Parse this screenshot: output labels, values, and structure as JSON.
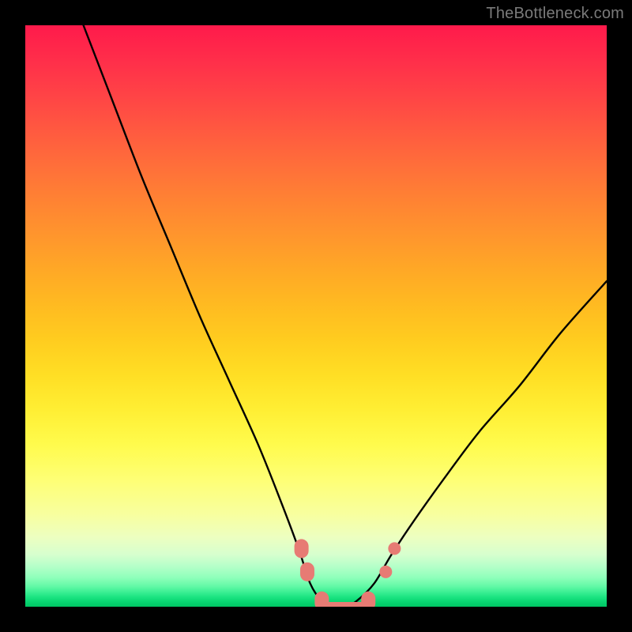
{
  "watermark": "TheBottleneck.com",
  "chart_data": {
    "type": "line",
    "title": "",
    "xlabel": "",
    "ylabel": "",
    "xlim": [
      0,
      100
    ],
    "ylim": [
      0,
      100
    ],
    "grid": false,
    "legend": false,
    "background_gradient": {
      "direction": "vertical",
      "stops": [
        {
          "pos": 0,
          "color": "#ff1a4b"
        },
        {
          "pos": 50,
          "color": "#ffc51f"
        },
        {
          "pos": 90,
          "color": "#d7ffce"
        },
        {
          "pos": 100,
          "color": "#01c764"
        }
      ]
    },
    "series": [
      {
        "name": "bottleneck-curve",
        "color": "#000000",
        "x": [
          10,
          15,
          20,
          25,
          30,
          35,
          40,
          44,
          47,
          49,
          51,
          53,
          55,
          57,
          60,
          63,
          67,
          72,
          78,
          85,
          92,
          100
        ],
        "values": [
          100,
          87,
          74,
          62,
          50,
          39,
          28,
          18,
          10,
          4,
          1,
          0,
          0,
          1,
          4,
          9,
          15,
          22,
          30,
          38,
          47,
          56
        ]
      }
    ],
    "markers": [
      {
        "name": "left-cluster-top",
        "x": 47.5,
        "y": 10,
        "color": "#e77b74",
        "shape": "pill"
      },
      {
        "name": "left-cluster-mid",
        "x": 48.5,
        "y": 6,
        "color": "#e77b74",
        "shape": "pill"
      },
      {
        "name": "trough-left",
        "x": 51,
        "y": 1,
        "color": "#e77b74",
        "shape": "pill"
      },
      {
        "name": "trough-center",
        "x": 55,
        "y": 0,
        "color": "#e77b74",
        "shape": "pill-wide"
      },
      {
        "name": "trough-right",
        "x": 59,
        "y": 1,
        "color": "#e77b74",
        "shape": "pill"
      },
      {
        "name": "right-cluster-mid",
        "x": 62,
        "y": 6,
        "color": "#e77b74",
        "shape": "dot"
      },
      {
        "name": "right-cluster-top",
        "x": 63.5,
        "y": 10,
        "color": "#e77b74",
        "shape": "dot"
      }
    ]
  }
}
